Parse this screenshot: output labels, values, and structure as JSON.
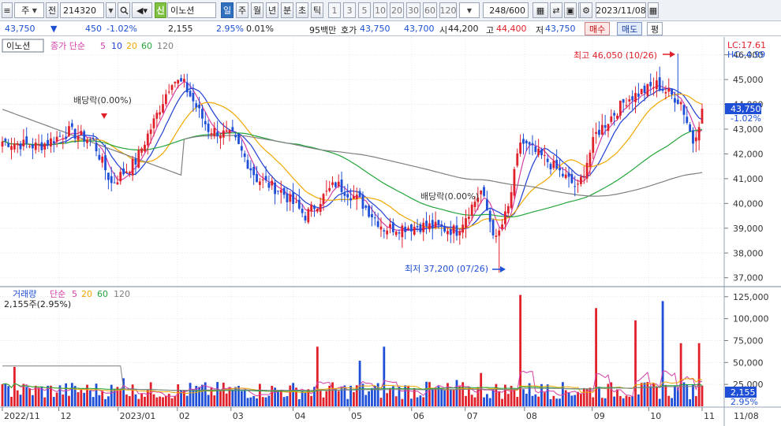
{
  "toolbar": {
    "market": "주",
    "prev_label": "전",
    "code": "214320",
    "stock_name": "이노션",
    "credit_badge": "신",
    "periods": [
      "일",
      "주",
      "월",
      "년",
      "분",
      "초",
      "틱"
    ],
    "active_period": "일",
    "minute_steps": [
      "1",
      "3",
      "5",
      "10",
      "20",
      "30",
      "60",
      "120"
    ],
    "count": "248/600",
    "date": "2023/11/08"
  },
  "info": {
    "stock_name": "이노션",
    "price": "43,750",
    "arrow": "▼",
    "change": "450",
    "change_pct": "-1.02%",
    "volume": "2,155",
    "volume_ratio": "2.95%",
    "turnover": "0.01%",
    "amount": "95백만",
    "ask_label": "호가",
    "ask": "43,750",
    "bid": "43,700",
    "open_label": "시",
    "open": "44,200",
    "high_label": "고",
    "high": "44,400",
    "low_label": "저",
    "low": "43,750",
    "buy_label": "매수",
    "sell_label": "매도",
    "eq_label": "평"
  },
  "price_panel": {
    "title": "이노션",
    "legend_prefix": "종가 단순",
    "ma_periods": [
      "5",
      "10",
      "20",
      "60",
      "120"
    ],
    "ma_colors": [
      "#d43fa8",
      "#1f3fd6",
      "#f0a800",
      "#22a53a",
      "#7f7f7f"
    ],
    "lc": "LC:17.61",
    "hc": "HC:-4.99",
    "high_annotation": "최고 46,050 (10/26)",
    "low_annotation": "최저 37,200 (07/26)",
    "dividend_label_1": "배당락(0.00%)",
    "dividend_label_2": "배당락(0.00%)",
    "current_price_tag": "43,750",
    "current_change_tag": "-1.02%",
    "y_axis_labels": [
      "46,000",
      "45,000",
      "44,000",
      "43,000",
      "42,000",
      "41,000",
      "40,000",
      "39,000",
      "38,000",
      "37,000"
    ]
  },
  "volume_panel": {
    "title": "거래량",
    "legend_prefix": "단순",
    "ma_periods": [
      "5",
      "20",
      "60",
      "120"
    ],
    "ma_colors": [
      "#d43fa8",
      "#f0a800",
      "#22a53a",
      "#7f7f7f"
    ],
    "volume_text": "2,155주(2.95%)",
    "current_volume_tag": "2,155",
    "current_pct_tag": "2.95%",
    "y_axis_labels": [
      "125,000",
      "100,000",
      "75,000",
      "50,000",
      "25,000"
    ]
  },
  "x_axis": {
    "labels": [
      "2022/11",
      "12",
      "2023/01",
      "02",
      "03",
      "04",
      "05",
      "06",
      "07",
      "08",
      "09",
      "10",
      "11"
    ],
    "right_label": "11/08"
  },
  "colors": {
    "up": "#e0202a",
    "down": "#1f4fd6",
    "accent": "#2f6fbf"
  },
  "chart_data": {
    "type": "candlestick",
    "ylim": [
      36800,
      46400
    ],
    "price_path": [
      {
        "i": 0,
        "c": 42500
      },
      {
        "i": 12,
        "c": 42300
      },
      {
        "i": 22,
        "c": 42900
      },
      {
        "i": 30,
        "c": 42500
      },
      {
        "i": 36,
        "c": 40800
      },
      {
        "i": 44,
        "c": 41700
      },
      {
        "i": 50,
        "c": 43300
      },
      {
        "i": 56,
        "c": 45000
      },
      {
        "i": 60,
        "c": 44800
      },
      {
        "i": 68,
        "c": 43000
      },
      {
        "i": 76,
        "c": 42700
      },
      {
        "i": 84,
        "c": 41000
      },
      {
        "i": 92,
        "c": 40500
      },
      {
        "i": 100,
        "c": 39500
      },
      {
        "i": 110,
        "c": 40800
      },
      {
        "i": 118,
        "c": 40100
      },
      {
        "i": 126,
        "c": 39000
      },
      {
        "i": 140,
        "c": 39100
      },
      {
        "i": 150,
        "c": 38900
      },
      {
        "i": 158,
        "c": 40500
      },
      {
        "i": 163,
        "c": 38500
      },
      {
        "i": 167,
        "c": 39800
      },
      {
        "i": 171,
        "c": 42500
      },
      {
        "i": 180,
        "c": 41700
      },
      {
        "i": 190,
        "c": 40600
      },
      {
        "i": 196,
        "c": 42800
      },
      {
        "i": 206,
        "c": 44200
      },
      {
        "i": 216,
        "c": 44800
      },
      {
        "i": 224,
        "c": 44100
      },
      {
        "i": 228,
        "c": 42500
      },
      {
        "i": 231,
        "c": 43700
      }
    ],
    "high_point": {
      "i": 223,
      "v": 46050
    },
    "low_point": {
      "i": 164,
      "v": 37200
    },
    "volume_spikes": [
      {
        "i": 4,
        "v": 45000
      },
      {
        "i": 40,
        "v": 32000
      },
      {
        "i": 104,
        "v": 68000
      },
      {
        "i": 118,
        "v": 52000
      },
      {
        "i": 126,
        "v": 68000
      },
      {
        "i": 140,
        "v": 28000
      },
      {
        "i": 150,
        "v": 30000
      },
      {
        "i": 158,
        "v": 38000
      },
      {
        "i": 171,
        "v": 127000
      },
      {
        "i": 180,
        "v": 25000
      },
      {
        "i": 196,
        "v": 112000
      },
      {
        "i": 209,
        "v": 98000
      },
      {
        "i": 218,
        "v": 120000
      },
      {
        "i": 224,
        "v": 72000
      },
      {
        "i": 230,
        "v": 72000
      }
    ]
  }
}
